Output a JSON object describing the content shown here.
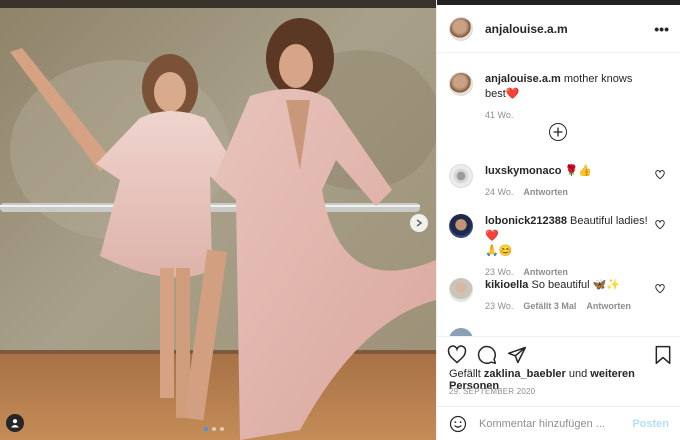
{
  "post": {
    "author": "anjalouise.a.m",
    "image": {
      "carousel_total": 3,
      "carousel_active": 1
    }
  },
  "header": {
    "username": "anjalouise.a.m",
    "more_icon": "more-horizontal-icon",
    "more_label": "•••"
  },
  "caption": {
    "username": "anjalouise.a.m",
    "text": "mother knows best",
    "emoji": "❤️",
    "time": "41 Wo."
  },
  "load_more_icon": "plus-circle-icon",
  "comments": [
    {
      "username": "luxskymonaco",
      "text": " 🌹👍",
      "time": "24 Wo.",
      "reply": "Antworten",
      "likes": ""
    },
    {
      "username": "lobonick212388",
      "text": " Beautiful ladies!❤️",
      "text2": "🙏😊",
      "time": "23 Wo.",
      "reply": "Antworten",
      "likes": ""
    },
    {
      "username": "kikioella",
      "text": " So beautiful 🦋✨",
      "time": "23 Wo.",
      "likes": "Gefällt 3 Mal",
      "reply": "Antworten"
    }
  ],
  "actions": {
    "like_icon": "heart-icon",
    "comment_icon": "comment-icon",
    "share_icon": "paper-plane-icon",
    "save_icon": "bookmark-icon"
  },
  "likes": {
    "prefix": "Gefällt ",
    "user": "zaklina_baebler",
    "mid": " und ",
    "others": "weiteren Personen"
  },
  "date": "29. SEPTEMBER 2020",
  "add_comment": {
    "emoji_icon": "smiley-icon",
    "placeholder": "Kommentar hinzufügen ...",
    "post_label": "Posten"
  },
  "colors": {
    "accent": "#3897f0",
    "post_disabled": "#b2dffc",
    "heart_red": "#ed4956"
  }
}
